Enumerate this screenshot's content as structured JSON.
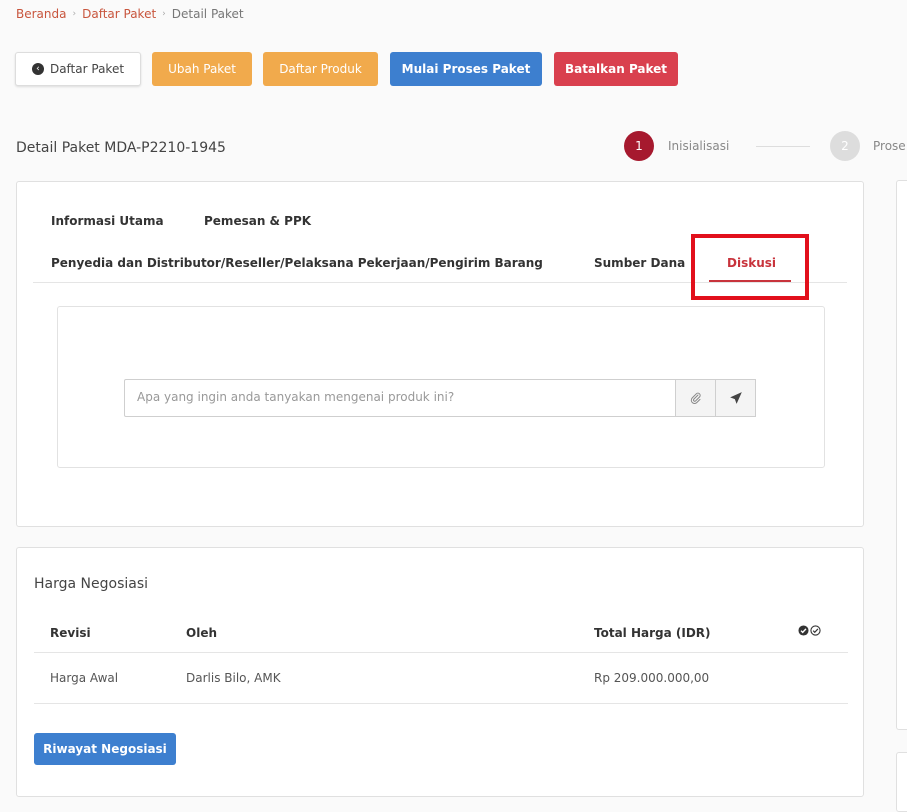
{
  "breadcrumb": {
    "items": [
      "Beranda",
      "Daftar Paket",
      "Detail Paket"
    ]
  },
  "toolbar": {
    "back_label": "Daftar Paket",
    "edit_label": "Ubah Paket",
    "products_label": "Daftar Produk",
    "start_label": "Mulai Proses Paket",
    "cancel_label": "Batalkan Paket"
  },
  "detail": {
    "title": "Detail Paket MDA-P2210-1945"
  },
  "stepper": {
    "steps": [
      {
        "number": "1",
        "label": "Inisialisasi"
      },
      {
        "number": "2",
        "label": "Prose"
      }
    ]
  },
  "tabs": {
    "items": [
      "Informasi Utama",
      "Pemesan & PPK",
      "Penyedia dan Distributor/Reseller/Pelaksana Pekerjaan/Pengirim Barang",
      "Sumber Dana",
      "Diskusi"
    ],
    "active": "Diskusi"
  },
  "discussion": {
    "placeholder": "Apa yang ingin anda tanyakan mengenai produk ini?"
  },
  "negotiation": {
    "title": "Harga Negosiasi",
    "columns": [
      "Revisi",
      "Oleh",
      "Total Harga (IDR)"
    ],
    "rows": [
      {
        "revisi": "Harga Awal",
        "oleh": "Darlis Bilo, AMK",
        "total": "Rp 209.000.000,00"
      }
    ],
    "history_button": "Riwayat Negosiasi"
  },
  "colors": {
    "warning": "#f1aa4c",
    "primary": "#3d7fcf",
    "danger": "#d9404e",
    "active_tab": "#c8333c",
    "highlight": "#e2101c",
    "step_active": "#a6192e"
  }
}
